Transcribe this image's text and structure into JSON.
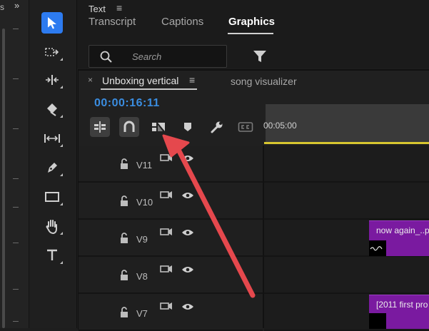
{
  "left_panel": {
    "title": "s",
    "expand_glyph": "»"
  },
  "tools": [
    {
      "name": "selection-tool-icon",
      "active": true
    },
    {
      "name": "track-select-tool-icon"
    },
    {
      "name": "ripple-edit-tool-icon"
    },
    {
      "name": "razor-tool-icon"
    },
    {
      "name": "slip-tool-icon"
    },
    {
      "name": "pen-tool-icon"
    },
    {
      "name": "rectangle-tool-icon"
    },
    {
      "name": "hand-tool-icon"
    },
    {
      "name": "type-tool-icon"
    }
  ],
  "top_panel": {
    "title": "Text",
    "menu_glyph": "≡",
    "tabs": [
      "Transcript",
      "Captions",
      "Graphics"
    ],
    "active_tab": "Graphics",
    "search": {
      "placeholder": "Search"
    }
  },
  "sequence": {
    "close_glyph": "×",
    "tabs": [
      "Unboxing vertical",
      "song visualizer"
    ],
    "active_tab": "Unboxing vertical",
    "menu_glyph": "≡",
    "timecode": "00:00:16:11",
    "ruler_label": "00:05:00"
  },
  "timeline_buttons": [
    "insert-nest-icon",
    "snap-magnet-icon",
    "linked-selection-icon",
    "add-marker-icon",
    "settings-wrench-icon",
    "captions-icon"
  ],
  "tracks": [
    {
      "name": "V11"
    },
    {
      "name": "V10"
    },
    {
      "name": "V9",
      "clip": "now again_..p"
    },
    {
      "name": "V8"
    },
    {
      "name": "V7",
      "clip": "[2011 first pro"
    }
  ],
  "colors": {
    "accent_blue": "#2d7bf0",
    "timecode_blue": "#3a8de0",
    "clip_purple": "#7a1aa0",
    "work_area_yellow": "#d8c630",
    "annotation_arrow_red": "#e5484d"
  }
}
